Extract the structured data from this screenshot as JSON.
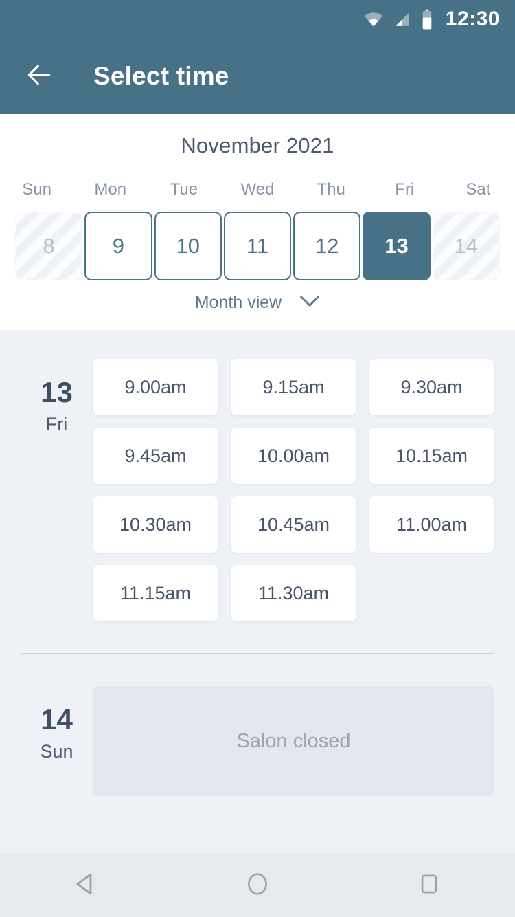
{
  "status_bar": {
    "time": "12:30",
    "icons": [
      "wifi-icon",
      "signal-icon",
      "battery-icon"
    ]
  },
  "app_bar": {
    "back_icon": "arrow-left-icon",
    "title": "Select time"
  },
  "calendar": {
    "month_title": "November 2021",
    "weekdays": [
      "Sun",
      "Mon",
      "Tue",
      "Wed",
      "Thu",
      "Fri",
      "Sat"
    ],
    "days": [
      {
        "number": "8",
        "state": "disabled"
      },
      {
        "number": "9",
        "state": "available"
      },
      {
        "number": "10",
        "state": "available"
      },
      {
        "number": "11",
        "state": "available"
      },
      {
        "number": "12",
        "state": "available"
      },
      {
        "number": "13",
        "state": "selected"
      },
      {
        "number": "14",
        "state": "disabled"
      }
    ],
    "month_view_label": "Month view",
    "month_view_icon": "chevron-down-icon"
  },
  "schedule": [
    {
      "day_number": "13",
      "day_of_week": "Fri",
      "slots": [
        "9.00am",
        "9.15am",
        "9.30am",
        "9.45am",
        "10.00am",
        "10.15am",
        "10.30am",
        "10.45am",
        "11.00am",
        "11.15am",
        "11.30am"
      ],
      "closed_message": ""
    },
    {
      "day_number": "14",
      "day_of_week": "Sun",
      "slots": [],
      "closed_message": "Salon closed"
    }
  ],
  "nav_bar": {
    "back_icon": "triangle-back-icon",
    "home_icon": "circle-home-icon",
    "recents_icon": "square-recents-icon"
  },
  "colors": {
    "header": "#477186",
    "selected_day": "#477186",
    "available_day_border": "#4c7487",
    "body_background": "#eef2f7",
    "slot_text": "#4a556a",
    "closed_chip": "#e4e7ed"
  }
}
